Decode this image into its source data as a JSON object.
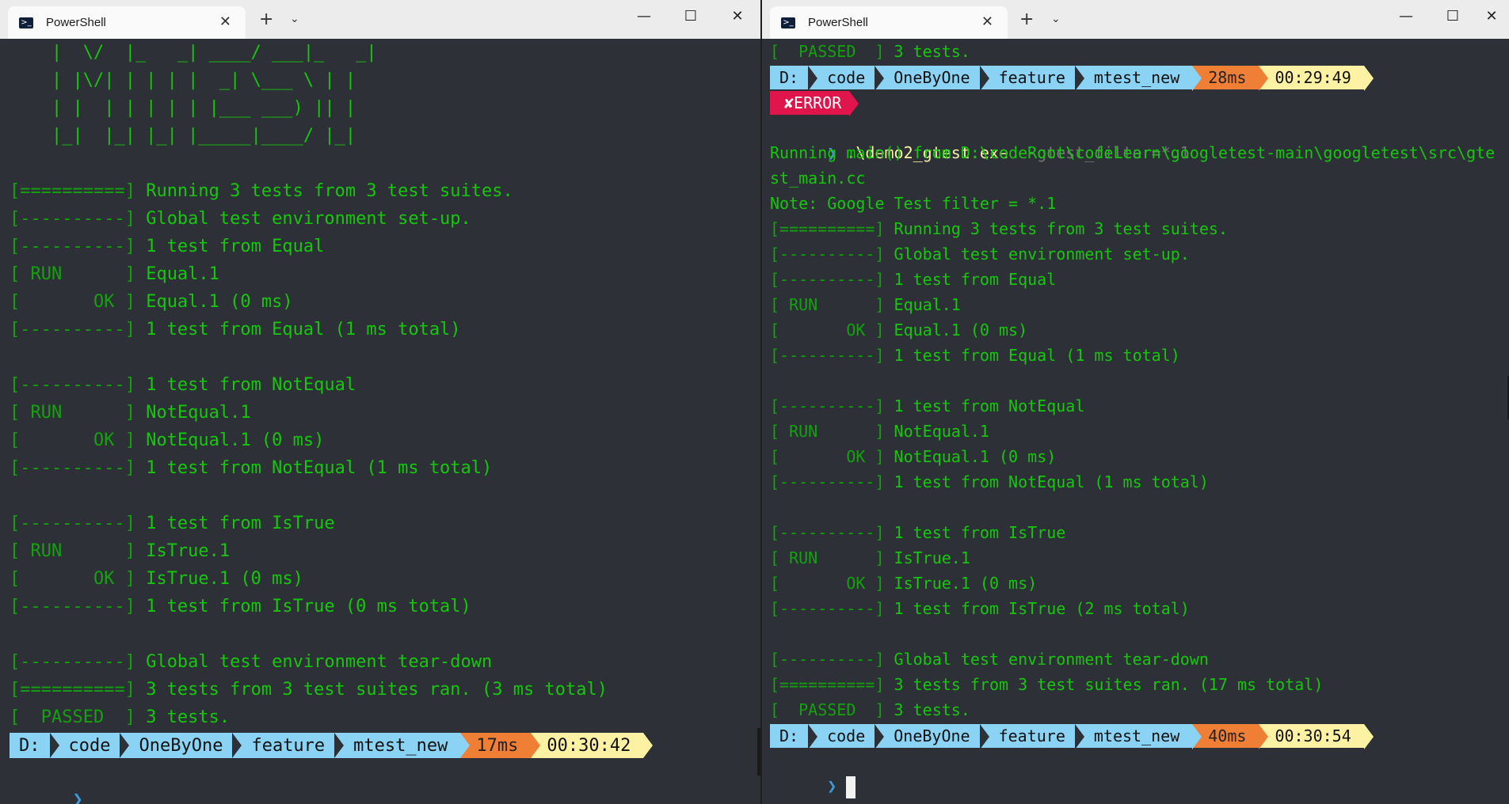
{
  "left": {
    "tab_title": "PowerShell",
    "new_tab": "+",
    "ascii_art": [
      "    |  \\/  |_   _| ____/ ___|_   _|",
      "    | |\\/| | | | |  _| \\___ \\ | |",
      "    | |  | | | | | |___ ___) || |",
      "    |_|  |_| |_| |_____|____/ |_|"
    ],
    "output": [
      {
        "br": "",
        "txt": ""
      },
      {
        "br": "[==========]",
        "txt": " Running 3 tests from 3 test suites."
      },
      {
        "br": "[----------]",
        "txt": " Global test environment set-up."
      },
      {
        "br": "[----------]",
        "txt": " 1 test from Equal"
      },
      {
        "br": "[ RUN      ]",
        "txt": " Equal.1"
      },
      {
        "br": "[       OK ]",
        "txt": " Equal.1 (0 ms)"
      },
      {
        "br": "[----------]",
        "txt": " 1 test from Equal (1 ms total)"
      },
      {
        "br": "",
        "txt": ""
      },
      {
        "br": "[----------]",
        "txt": " 1 test from NotEqual"
      },
      {
        "br": "[ RUN      ]",
        "txt": " NotEqual.1"
      },
      {
        "br": "[       OK ]",
        "txt": " NotEqual.1 (0 ms)"
      },
      {
        "br": "[----------]",
        "txt": " 1 test from NotEqual (1 ms total)"
      },
      {
        "br": "",
        "txt": ""
      },
      {
        "br": "[----------]",
        "txt": " 1 test from IsTrue"
      },
      {
        "br": "[ RUN      ]",
        "txt": " IsTrue.1"
      },
      {
        "br": "[       OK ]",
        "txt": " IsTrue.1 (0 ms)"
      },
      {
        "br": "[----------]",
        "txt": " 1 test from IsTrue (0 ms total)"
      },
      {
        "br": "",
        "txt": ""
      },
      {
        "br": "[----------]",
        "txt": " Global test environment tear-down"
      },
      {
        "br": "[==========]",
        "txt": " 3 tests from 3 test suites ran. (3 ms total)"
      },
      {
        "br": "[  PASSED  ]",
        "txt": " 3 tests."
      }
    ],
    "prompt_path": [
      "D:",
      "code",
      "OneByOne",
      "feature",
      "mtest_new"
    ],
    "duration": "17ms",
    "time": "00:30:42",
    "prompt_glyph": "❯"
  },
  "right": {
    "tab_title": "PowerShell",
    "new_tab": "+",
    "top_output": {
      "br": "[  PASSED  ]",
      "txt": " 3 tests."
    },
    "prompt1_path": [
      "D:",
      "code",
      "OneByOne",
      "feature",
      "mtest_new"
    ],
    "prompt1_duration": "28ms",
    "prompt1_time": "00:29:49",
    "error_label": "✘ERROR",
    "command": ".\\demo2_gtest.exe",
    "command_arg": "--gtest_filter=*.1",
    "prompt_glyph": "❯",
    "running_main_1": "Running main() from D:\\codeRoot\\codeLearn\\googletest-main\\googletest\\src\\gte",
    "running_main_2": "st_main.cc",
    "filter_note": "Note: Google Test filter = *.1",
    "output": [
      {
        "br": "[==========]",
        "txt": " Running 3 tests from 3 test suites."
      },
      {
        "br": "[----------]",
        "txt": " Global test environment set-up."
      },
      {
        "br": "[----------]",
        "txt": " 1 test from Equal"
      },
      {
        "br": "[ RUN      ]",
        "txt": " Equal.1"
      },
      {
        "br": "[       OK ]",
        "txt": " Equal.1 (0 ms)"
      },
      {
        "br": "[----------]",
        "txt": " 1 test from Equal (1 ms total)"
      },
      {
        "br": "",
        "txt": ""
      },
      {
        "br": "[----------]",
        "txt": " 1 test from NotEqual"
      },
      {
        "br": "[ RUN      ]",
        "txt": " NotEqual.1"
      },
      {
        "br": "[       OK ]",
        "txt": " NotEqual.1 (0 ms)"
      },
      {
        "br": "[----------]",
        "txt": " 1 test from NotEqual (1 ms total)"
      },
      {
        "br": "",
        "txt": ""
      },
      {
        "br": "[----------]",
        "txt": " 1 test from IsTrue"
      },
      {
        "br": "[ RUN      ]",
        "txt": " IsTrue.1"
      },
      {
        "br": "[       OK ]",
        "txt": " IsTrue.1 (0 ms)"
      },
      {
        "br": "[----------]",
        "txt": " 1 test from IsTrue (2 ms total)"
      },
      {
        "br": "",
        "txt": ""
      },
      {
        "br": "[----------]",
        "txt": " Global test environment tear-down"
      },
      {
        "br": "[==========]",
        "txt": " 3 tests from 3 test suites ran. (17 ms total)"
      },
      {
        "br": "[  PASSED  ]",
        "txt": " 3 tests."
      }
    ],
    "prompt2_path": [
      "D:",
      "code",
      "OneByOne",
      "feature",
      "mtest_new"
    ],
    "prompt2_duration": "40ms",
    "prompt2_time": "00:30:54"
  },
  "colors": {
    "terminal_bg": "#2d3137",
    "green_text": "#16c60c",
    "path_segment": "#8ad3f5",
    "duration_segment": "#f07f36",
    "time_segment": "#fdf1a3",
    "error_segment": "#e0154b"
  },
  "icons": {
    "tab_icon": "powershell-icon",
    "close": "close-icon",
    "minimize": "minimize-icon",
    "maximize": "maximize-icon",
    "dropdown": "chevron-down-icon"
  }
}
